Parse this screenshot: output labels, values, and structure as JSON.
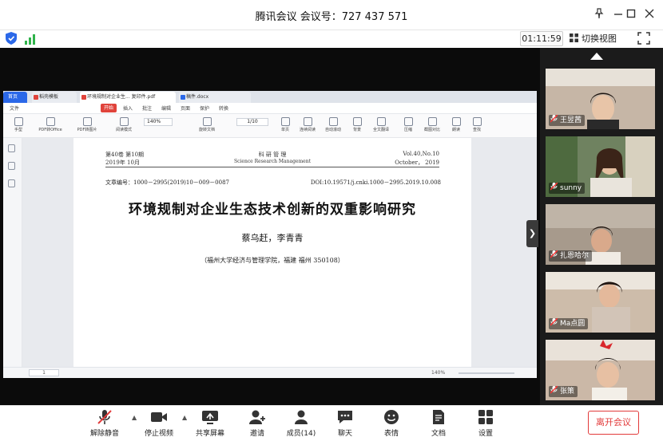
{
  "window": {
    "title": "腾讯会议 会议号：727 437 571"
  },
  "status": {
    "timer": "01:11:59",
    "switch_view": "切换视图"
  },
  "document": {
    "tabs": [
      "首页",
      "稻壳模板",
      "环境规制对企业生... 复印件.pdf",
      "稿件.docx"
    ],
    "menu": [
      "文件",
      "开始",
      "插入",
      "批注",
      "编辑",
      "页面",
      "保护",
      "转换"
    ],
    "toolbar": [
      "手型",
      "选择",
      "PDF转Office",
      "PDF转图片",
      "阅读模式",
      "旋转文档",
      "单页",
      "双页",
      "连续阅读",
      "自动滚动",
      "背景",
      "全文翻译",
      "压缩",
      "截图对比",
      "朗读",
      "查找"
    ],
    "zoom": "140%",
    "page_indicator": "1/10",
    "bottom_page": "1",
    "bottom_zoom": "140%"
  },
  "paper": {
    "header_left": "第40卷 第10期",
    "header_left2": "2019年 10月",
    "header_center": "科 研 管 理",
    "header_center2": "Science Research Management",
    "header_right": "Vol.40,No.10",
    "header_right2": "October， 2019",
    "ref": "文章编号：1000－2995(2019)10－009－0087",
    "doi": "DOI:10.19571/j.cnki.1000－2995.2019.10.008",
    "title": "环境规制对企业生态技术创新的双重影响研究",
    "authors": "蔡乌赶，李青青",
    "affiliation": "（福州大学经济与管理学院，福建 福州  350108）"
  },
  "participants": [
    {
      "name": "王昱茜",
      "bg": "#b8a89a"
    },
    {
      "name": "sunny",
      "bg": "#7a8b6e"
    },
    {
      "name": "扎恩哈尔",
      "bg": "#a19487"
    },
    {
      "name": "Ma点圆",
      "bg": "#c9b8a6"
    },
    {
      "name": "张策",
      "bg": "#c6b3a3"
    }
  ],
  "controls": {
    "mute": "解除静音",
    "stop_video": "停止视频",
    "share": "共享屏幕",
    "invite": "邀请",
    "members": "成员(14)",
    "chat": "聊天",
    "reaction": "表情",
    "docs": "文档",
    "settings": "设置",
    "leave": "离开会议"
  },
  "colors": {
    "accent_red": "#e23a3a",
    "highlight": "#fff23a",
    "tab_blue": "#2b68e8"
  }
}
